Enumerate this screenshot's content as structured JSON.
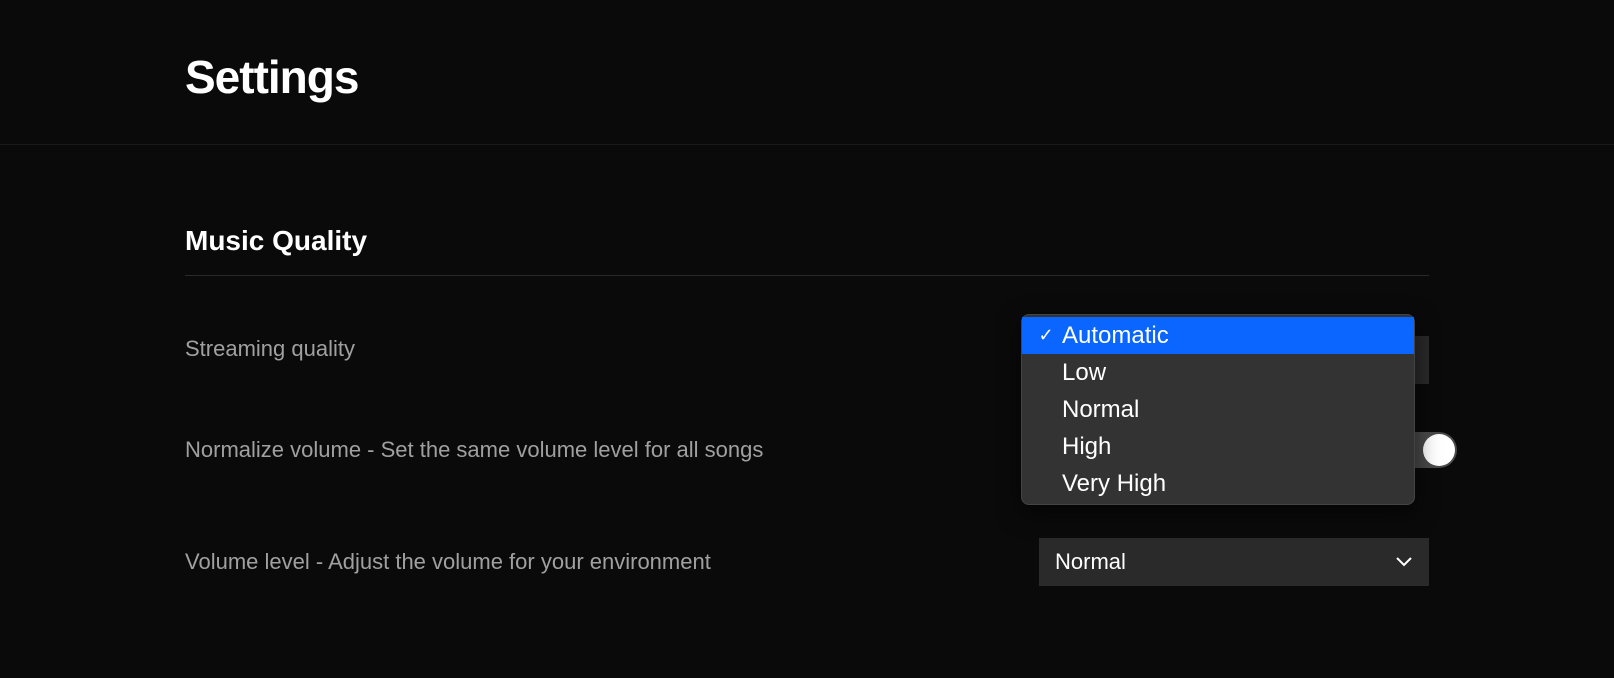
{
  "page": {
    "title": "Settings"
  },
  "section": {
    "title": "Music Quality"
  },
  "streaming_quality": {
    "label": "Streaming quality",
    "selected": "Automatic",
    "options": [
      "Automatic",
      "Low",
      "Normal",
      "High",
      "Very High"
    ]
  },
  "normalize_volume": {
    "label": "Normalize volume - Set the same volume level for all songs"
  },
  "volume_level": {
    "label": "Volume level - Adjust the volume for your environment",
    "selected": "Normal"
  }
}
